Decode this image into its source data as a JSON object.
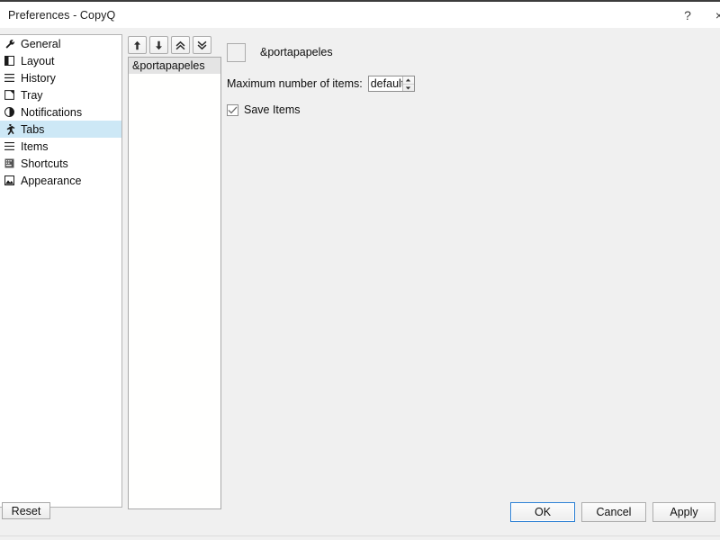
{
  "window": {
    "title": "Preferences - CopyQ",
    "help_label": "?",
    "close_label": "×"
  },
  "sidebar": {
    "items": [
      {
        "label": "General",
        "icon": "wrench-icon",
        "selected": false
      },
      {
        "label": "Layout",
        "icon": "layout-icon",
        "selected": false
      },
      {
        "label": "History",
        "icon": "list-icon",
        "selected": false
      },
      {
        "label": "Tray",
        "icon": "tray-icon",
        "selected": false
      },
      {
        "label": "Notifications",
        "icon": "bell-icon",
        "selected": false
      },
      {
        "label": "Tabs",
        "icon": "tabs-icon",
        "selected": true
      },
      {
        "label": "Items",
        "icon": "items-list-icon",
        "selected": false
      },
      {
        "label": "Shortcuts",
        "icon": "keyboard-icon",
        "selected": false
      },
      {
        "label": "Appearance",
        "icon": "appearance-icon",
        "selected": false
      }
    ]
  },
  "tab_toolbar": {
    "buttons": [
      {
        "name": "move-up-button",
        "icon": "arrow-up-icon"
      },
      {
        "name": "move-down-button",
        "icon": "arrow-down-icon"
      },
      {
        "name": "move-to-top-button",
        "icon": "double-arrow-up-icon"
      },
      {
        "name": "move-to-bottom-button",
        "icon": "double-arrow-down-icon"
      }
    ]
  },
  "tab_list": {
    "items": [
      {
        "label": "&portapapeles",
        "selected": true
      }
    ]
  },
  "pane": {
    "tab_name": "&portapapeles",
    "max_items_label": "Maximum number of items:",
    "max_items_value": "default",
    "save_items_label": "Save Items",
    "save_items_checked": true
  },
  "footer": {
    "reset_label": "Reset",
    "ok_label": "OK",
    "cancel_label": "Cancel",
    "apply_label": "Apply"
  },
  "colors": {
    "selection_blue": "#cde8f6",
    "list_selection_gray": "#e4e4e4",
    "window_bg": "#f0f0f0",
    "focus_border": "#2a7fd4"
  }
}
